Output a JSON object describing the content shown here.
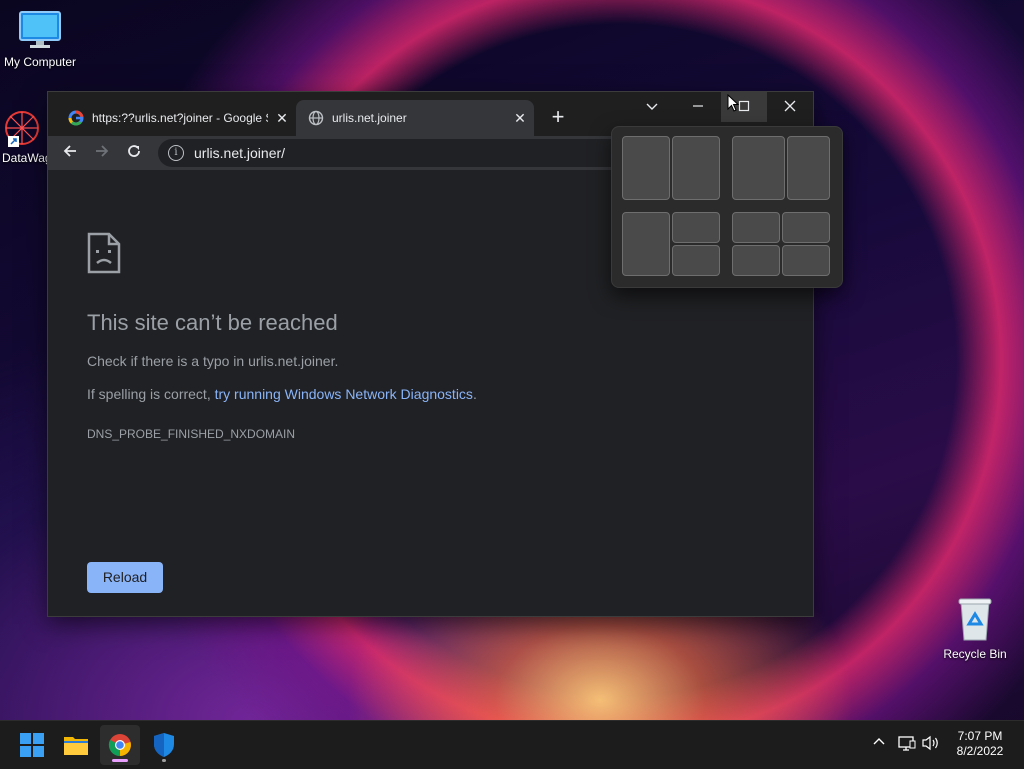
{
  "desktop": {
    "icons": [
      {
        "label": "My Computer"
      },
      {
        "label": "DataWag"
      },
      {
        "label": "Recycle Bin"
      }
    ]
  },
  "browser": {
    "tabs": [
      {
        "title": "https:??urlis.net?joiner - Google S",
        "icon": "google-icon"
      },
      {
        "title": "urlis.net.joiner",
        "icon": "globe-icon"
      }
    ],
    "new_tab": "+",
    "address": "urlis.net.joiner/",
    "error": {
      "title": "This site can’t be reached",
      "line1": "Check if there is a typo in urlis.net.joiner.",
      "line2_prefix": "If spelling is correct, ",
      "line2_link": "try running Windows Network Diagnostics",
      "line2_suffix": ".",
      "code": "DNS_PROBE_FINISHED_NXDOMAIN",
      "reload_label": "Reload"
    }
  },
  "taskbar": {
    "time": "7:07 PM",
    "date": "8/2/2022"
  },
  "colors": {
    "link": "#8ab4f8",
    "button": "#8ab4f8",
    "page_bg": "#202124"
  }
}
